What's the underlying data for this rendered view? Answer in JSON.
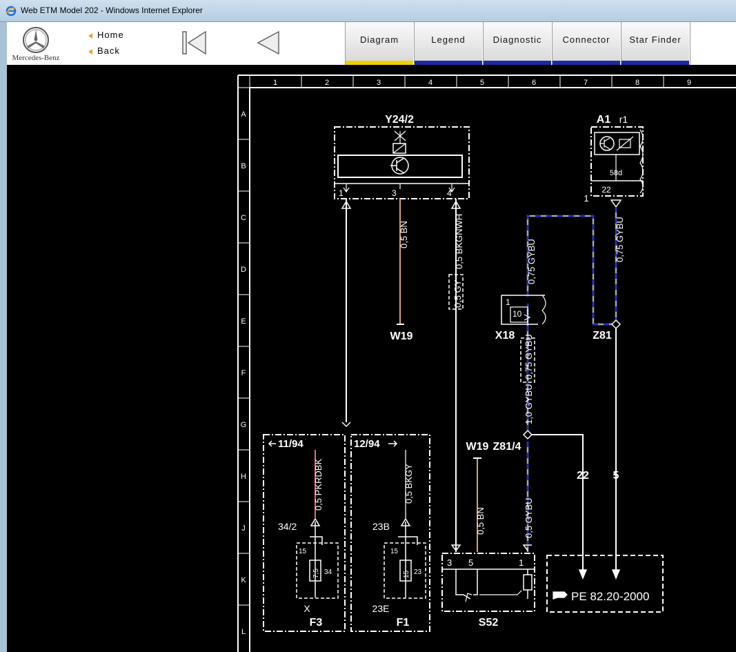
{
  "window": {
    "title": "Web ETM Model 202 - Windows Internet Explorer"
  },
  "toolbar": {
    "brand": "Mercedes-Benz",
    "home_label": "Home",
    "back_label": "Back",
    "tabs": [
      {
        "label": "Diagram",
        "color": "#f0d000"
      },
      {
        "label": "Legend",
        "color": "#1a2aa0"
      },
      {
        "label": "Diagnostic",
        "color": "#1a2aa0"
      },
      {
        "label": "Connector",
        "color": "#1a2aa0"
      },
      {
        "label": "Star Finder",
        "color": "#1a2aa0"
      }
    ]
  },
  "grid": {
    "columns": [
      "1",
      "2",
      "3",
      "4",
      "5",
      "6",
      "7",
      "8",
      "9"
    ],
    "rows": [
      "A",
      "B",
      "C",
      "D",
      "E",
      "F",
      "G",
      "H",
      "J",
      "K",
      "L"
    ]
  },
  "diagram": {
    "y24_label": "Y24/2",
    "y24_pin1": "1",
    "y24_pin3": "3",
    "y24_pin4": "4",
    "wire_bn": "0,5 BN",
    "wire_bkgnwh": "0,5 BKGNWH",
    "wire_gy": "0,5 GY",
    "w19_top": "W19",
    "a1_label": "A1",
    "a1_r1": "r1",
    "a1_58d": "58d",
    "a1_22": "22",
    "a1_1": "1",
    "wire_gybu_a1": "0,75 GYBU",
    "wire_gybu_x18": "0,75 GYBU",
    "x18_label": "X18",
    "x18_1": "1",
    "x18_10": "10",
    "z81_label": "Z81",
    "wire_gybu_mid": "0,75 GYBU",
    "wire_gybu_10": "1,0 GYBU",
    "z814_label": "Z81/4",
    "w19_bottom": "W19",
    "wire_22": "22",
    "wire_5": "5",
    "ref_1194": "11/94",
    "ref_1294": "12/94",
    "wire_pkrdbk": "0,5 PKRDBK",
    "wire_bkgy": "0,5 BKGY",
    "f3_pin_top": "34/2",
    "f3_15": "15",
    "f3_75": "7,5",
    "f3_34": "34",
    "f3_x": "X",
    "f3_label": "F3",
    "f1_pin_top": "23B",
    "f1_15": "15",
    "f1_15b": "15",
    "f1_23": "23",
    "f1_23e": "23E",
    "f1_label": "F1",
    "wire_bn_s52": "0,5 BN",
    "wire_gybu_s52": "0,5 GYBU",
    "s52_3": "3",
    "s52_5": "5",
    "s52_1": "1",
    "s52_label": "S52",
    "pe_ref": "PE  82.20-2000"
  }
}
